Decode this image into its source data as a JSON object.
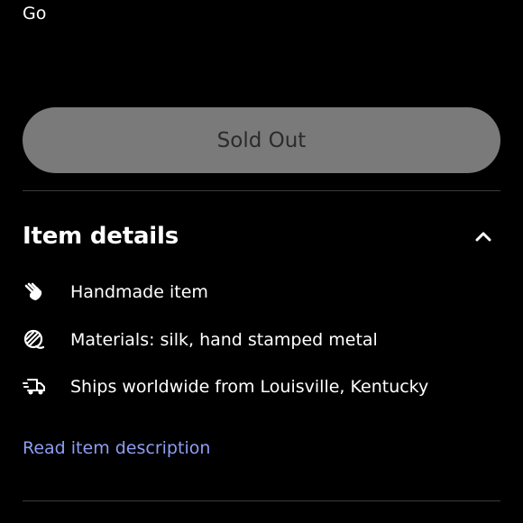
{
  "top": {
    "text": "Go"
  },
  "purchase": {
    "button_label": "Sold Out"
  },
  "details": {
    "title": "Item details",
    "toggle_icon": "chevron-up-icon",
    "items": [
      {
        "icon": "hand-icon",
        "text": "Handmade item"
      },
      {
        "icon": "yarn-ball-icon",
        "text": "Materials: silk, hand stamped metal"
      },
      {
        "icon": "delivery-truck-icon",
        "text": "Ships worldwide from Louisville, Kentucky"
      }
    ],
    "read_more_label": "Read item description"
  },
  "colors": {
    "background": "#000000",
    "button_bg": "#7a7a7a",
    "button_text": "#2b2b2b",
    "link": "#8e9ef2",
    "divider": "#3a3a3a"
  }
}
